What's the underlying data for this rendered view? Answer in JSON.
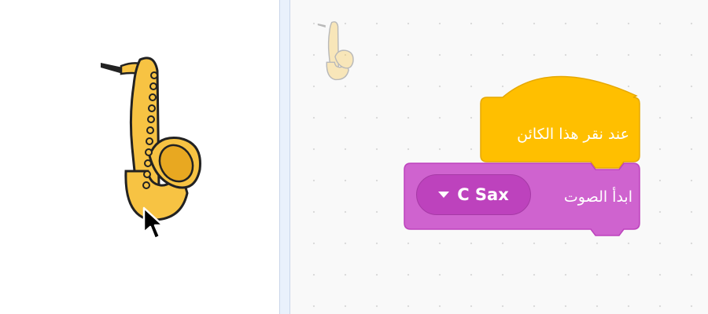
{
  "stage": {
    "sprite_name": "saxophone-sprite"
  },
  "code_area": {
    "hat_block": {
      "label": "عند نقر هذا الكائن",
      "color": "#ffbf00"
    },
    "sound_block": {
      "label": "ابدأ الصوت",
      "sound_value": "C Sax",
      "color": "#cf63cf",
      "dropdown_color": "#bd42bd"
    }
  },
  "icons": {
    "sprite": "saxophone-icon",
    "cursor": "mouse-pointer-icon",
    "dropdown": "triangle-down-icon"
  }
}
